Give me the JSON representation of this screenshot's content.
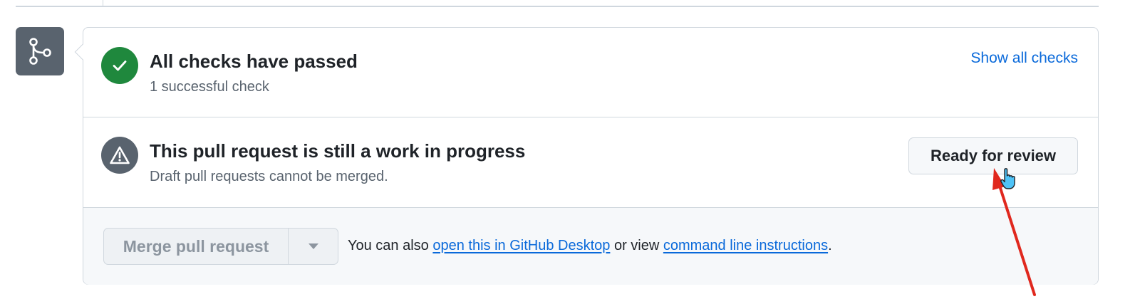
{
  "checks": {
    "title": "All checks have passed",
    "subtitle": "1 successful check",
    "show_all_label": "Show all checks",
    "status_color": "#1f883d"
  },
  "draft": {
    "title": "This pull request is still a work in progress",
    "subtitle": "Draft pull requests cannot be merged.",
    "ready_label": "Ready for review"
  },
  "merge": {
    "button_label": "Merge pull request",
    "help_prefix": "You can also ",
    "desktop_link": "open this in GitHub Desktop",
    "help_middle": " or view ",
    "cli_link": "command line instructions",
    "help_suffix": "."
  },
  "icons": {
    "badge": "git-merge-icon",
    "checks": "check-icon",
    "draft": "alert-icon",
    "caret": "triangle-down-icon",
    "cursor": "hand-pointer-icon"
  },
  "colors": {
    "accent_link": "#0969da",
    "annotation_arrow": "#e0281e",
    "neutral_icon": "#59636e"
  }
}
